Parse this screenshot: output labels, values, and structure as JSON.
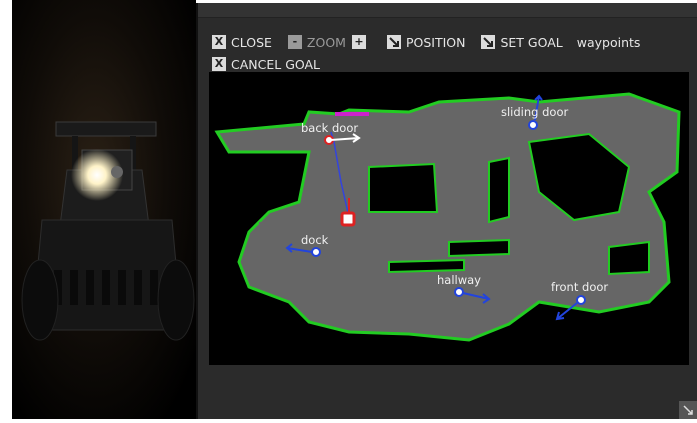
{
  "toolbar": {
    "close_icon": "X",
    "close_label": "CLOSE",
    "zoom_out_icon": "-",
    "zoom_label": "ZOOM",
    "zoom_in_icon": "+",
    "position_label": "POSITION",
    "set_goal_label": "SET GOAL",
    "waypoints_label": "waypoints",
    "cancel_icon": "X",
    "cancel_goal_label": "CANCEL GOAL"
  },
  "waypoints": [
    {
      "label": "back door"
    },
    {
      "label": "sliding door"
    },
    {
      "label": "dock"
    },
    {
      "label": "hallway"
    },
    {
      "label": "front door"
    }
  ],
  "colors": {
    "map_free": "#666666",
    "map_wall": "#22cc22",
    "map_unknown": "#000000",
    "waypoint": "#2244dd",
    "robot": "#dd2222",
    "path": "#cc22cc"
  },
  "icons": {
    "tool_arrow": "arrow-icon",
    "resize": "resize-grip-icon",
    "robot": "robot-marker-icon"
  }
}
